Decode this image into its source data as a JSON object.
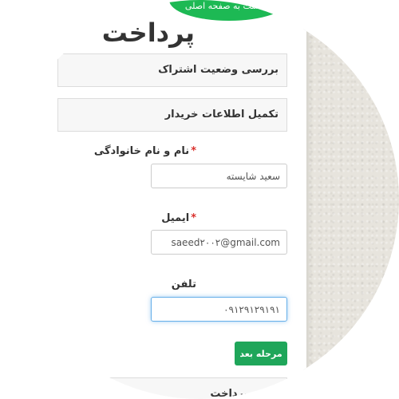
{
  "top_link": "بازگشت به صفحه اصلی",
  "page_title": "پرداخت",
  "panels": {
    "subscription_status": "بررسی وضعیت اشتراک",
    "buyer_info": "تکمیل اطلاعات خریدار",
    "payment_method": "شیوه پرداخت"
  },
  "form": {
    "name_label": "نام و نام خانوادگی",
    "name_value": "سعید شایسته",
    "email_label": "ایمیل",
    "email_value": "saeed۲۰۰۲@gmail.com",
    "phone_label": "تلفن",
    "phone_value": "۰۹۱۲۹۱۲۹۱۹۱",
    "required_mark": "*"
  },
  "next_button": "مرحله بعد",
  "colors": {
    "accent_green": "#1fa65a",
    "required_red": "#d9302c",
    "focus_blue": "#66afe9"
  }
}
